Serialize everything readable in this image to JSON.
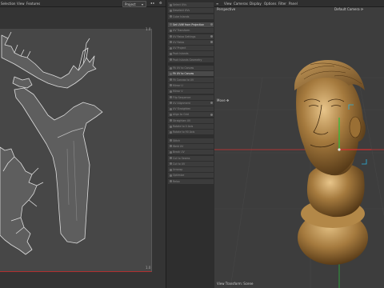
{
  "uv_editor": {
    "menu": [
      "Selection",
      "View",
      "Features"
    ],
    "select_value": "Project",
    "tick_top_right": "1.0",
    "tick_bottom_right": "1.0"
  },
  "command_panel": {
    "items": [
      {
        "label": "Select UVs",
        "highlight": false
      },
      {
        "label": "Deselect UVs",
        "highlight": false
      },
      {
        "label": "Cube Islands",
        "highlight": false
      },
      {
        "label": "Set UVW from Projection",
        "highlight": true
      },
      {
        "label": "UV Transform",
        "highlight": false
      },
      {
        "label": "UV Relax Settings",
        "highlight": false
      },
      {
        "label": "UV Relax",
        "highlight": false
      },
      {
        "label": "UV Project",
        "highlight": false
      },
      {
        "label": "Pack Islands",
        "highlight": false
      },
      {
        "label": "Pack Islands Geometry",
        "highlight": false
      },
      {
        "label": "Fit UV to Canvas",
        "highlight": false
      },
      {
        "label": "Fit UV to Canvas",
        "highlight": true
      },
      {
        "label": "Fit Canvas to UV",
        "highlight": false
      },
      {
        "label": "Mirror U",
        "highlight": false
      },
      {
        "label": "Mirror V",
        "highlight": false
      },
      {
        "label": "Flip Sequence",
        "highlight": false
      },
      {
        "label": "UV Alignment",
        "highlight": false
      },
      {
        "label": "UV Straighten",
        "highlight": false
      },
      {
        "label": "Align to Grid",
        "highlight": false
      },
      {
        "label": "Straighten UV",
        "highlight": false
      },
      {
        "label": "Rotate to 0 Axis",
        "highlight": false
      },
      {
        "label": "Rotate to 90 Axis",
        "highlight": false
      },
      {
        "label": "Stitch",
        "highlight": false
      },
      {
        "label": "Weld UV",
        "highlight": false
      },
      {
        "label": "Break UV",
        "highlight": false
      },
      {
        "label": "Cut to Seams",
        "highlight": false
      },
      {
        "label": "Cut to UV",
        "highlight": false
      },
      {
        "label": "Unwrap",
        "highlight": false
      },
      {
        "label": "Optimize",
        "highlight": false
      },
      {
        "label": "Relax",
        "highlight": false
      }
    ]
  },
  "viewport": {
    "menu": [
      "View",
      "Cameras",
      "Display",
      "Options",
      "Filter",
      "Panel"
    ],
    "view_name": "Perspective",
    "camera_name": "Default Camera ⟳",
    "tool_label": "Move ✥",
    "status": "View Transform: Scene"
  },
  "colors": {
    "bust_base": "#a57a3e",
    "bust_highlight": "#e8c58a",
    "bust_shadow": "#4f3414",
    "axis_green": "#29c23a",
    "axis_red": "#d63030",
    "selection_cyan": "#2ab3e0",
    "uv_edge": "#d8d8d8"
  }
}
